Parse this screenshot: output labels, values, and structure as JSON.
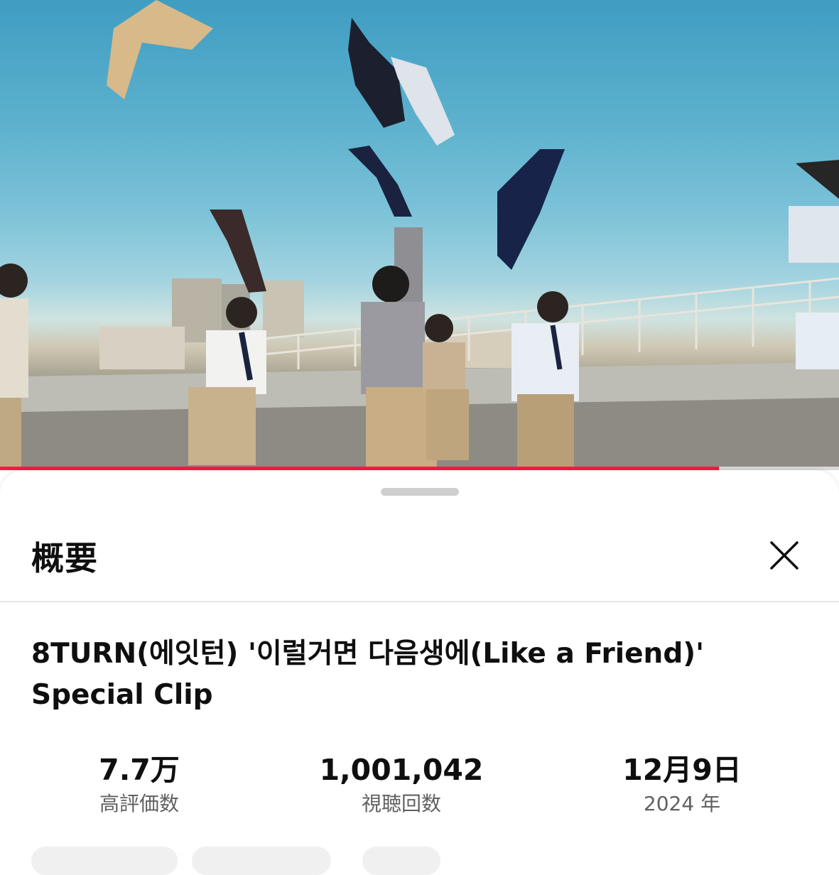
{
  "player": {
    "progress_fraction": 0.857,
    "progress_color": "#ff1744"
  },
  "sheet": {
    "title": "概要",
    "close_icon": "close-icon"
  },
  "video": {
    "title_line1": "8TURN(에잇턴) '이럴거면 다음생에(Like a Friend)'",
    "title_line2": "Special Clip"
  },
  "stats": {
    "likes_value": "7.7万",
    "likes_label": "高評価数",
    "views_value": "1,001,042",
    "views_label": "視聴回数",
    "date_value": "12月9日",
    "date_year": "2024 年"
  }
}
